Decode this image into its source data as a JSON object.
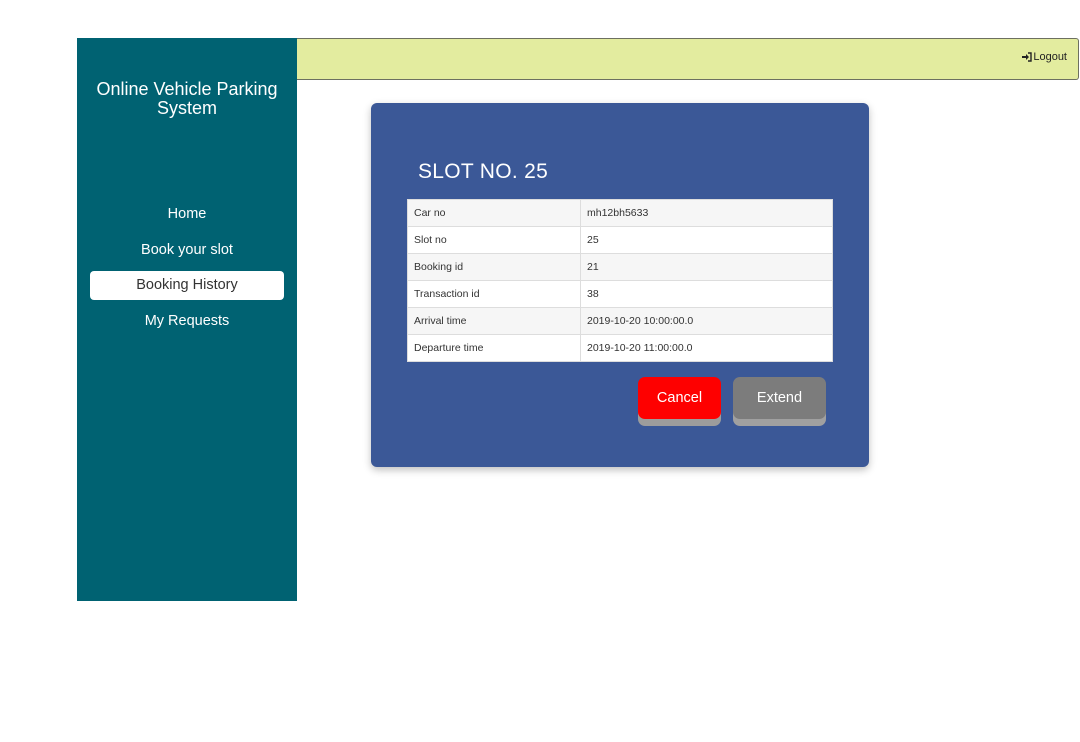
{
  "sidebar": {
    "app_title": "Online Vehicle Parking System",
    "items": [
      {
        "label": "Home",
        "active": false
      },
      {
        "label": "Book your slot",
        "active": false
      },
      {
        "label": "Booking History",
        "active": true
      },
      {
        "label": "My Requests",
        "active": false
      }
    ],
    "background_color": "#006272"
  },
  "topbar": {
    "logout_label": "Logout",
    "logout_icon": "sign-out-icon",
    "background_color": "#e3ec9f"
  },
  "booking": {
    "title": "SLOT NO. 25",
    "rows": [
      {
        "label": "Car no",
        "value": "mh12bh5633"
      },
      {
        "label": "Slot no",
        "value": "25"
      },
      {
        "label": "Booking id",
        "value": "21"
      },
      {
        "label": "Transaction id",
        "value": "38"
      },
      {
        "label": "Arrival time",
        "value": "2019-10-20 10:00:00.0"
      },
      {
        "label": "Departure time",
        "value": "2019-10-20 11:00:00.0"
      }
    ],
    "cancel_label": "Cancel",
    "extend_label": "Extend",
    "card_color": "#3b5897",
    "cancel_color": "#fe0000",
    "extend_color": "#7c7c7c"
  }
}
